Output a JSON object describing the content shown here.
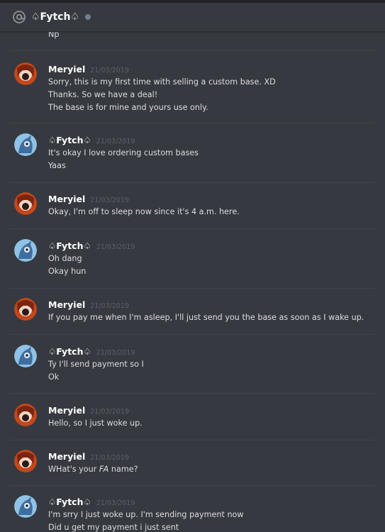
{
  "header": {
    "channel_name": "♤Fytch♤"
  },
  "top_fragment": "Np",
  "messages": [
    {
      "author": "Meryiel",
      "timestamp": "21/03/2019",
      "lines": [
        "Sorry, this is my first time with selling a custom base. XD",
        "Thanks. So we have a deal!",
        "The base is for mine and yours use only."
      ]
    },
    {
      "author": "♤Fytch♤",
      "timestamp": "21/03/2019",
      "lines": [
        "It's okay I love ordering custom bases",
        "Yaas"
      ]
    },
    {
      "author": "Meryiel",
      "timestamp": "21/03/2019",
      "lines": [
        "Okay, I'm off to sleep now since it's 4 a.m. here."
      ]
    },
    {
      "author": "♤Fytch♤",
      "timestamp": "21/03/2019",
      "lines": [
        "Oh dang",
        "Okay hun"
      ]
    },
    {
      "author": "Meryiel",
      "timestamp": "21/03/2019",
      "lines": [
        "If you pay me when I'm asleep, I'll just send you the base as soon as I wake up."
      ]
    },
    {
      "author": "♤Fytch♤",
      "timestamp": "21/03/2019",
      "lines": [
        "Ty I'll send payment so I",
        "Ok"
      ]
    },
    {
      "author": "Meryiel",
      "timestamp": "21/03/2019",
      "lines": [
        "Hello, so I just woke up."
      ]
    },
    {
      "author": "Meryiel",
      "timestamp": "21/03/2019",
      "lines": [
        "WHat's your",
        "FA",
        "name?"
      ]
    },
    {
      "author": "♤Fytch♤",
      "timestamp": "21/03/2019",
      "lines": [
        "I'm srry I just woke up. I'm sending payment now",
        "Did u get my payment i just sent"
      ]
    }
  ],
  "colors": {
    "background": "#36393f",
    "author": "#ffffff",
    "text": "#dcddde",
    "timestamp": "#5d6066",
    "status_idle": "#747f8d"
  }
}
